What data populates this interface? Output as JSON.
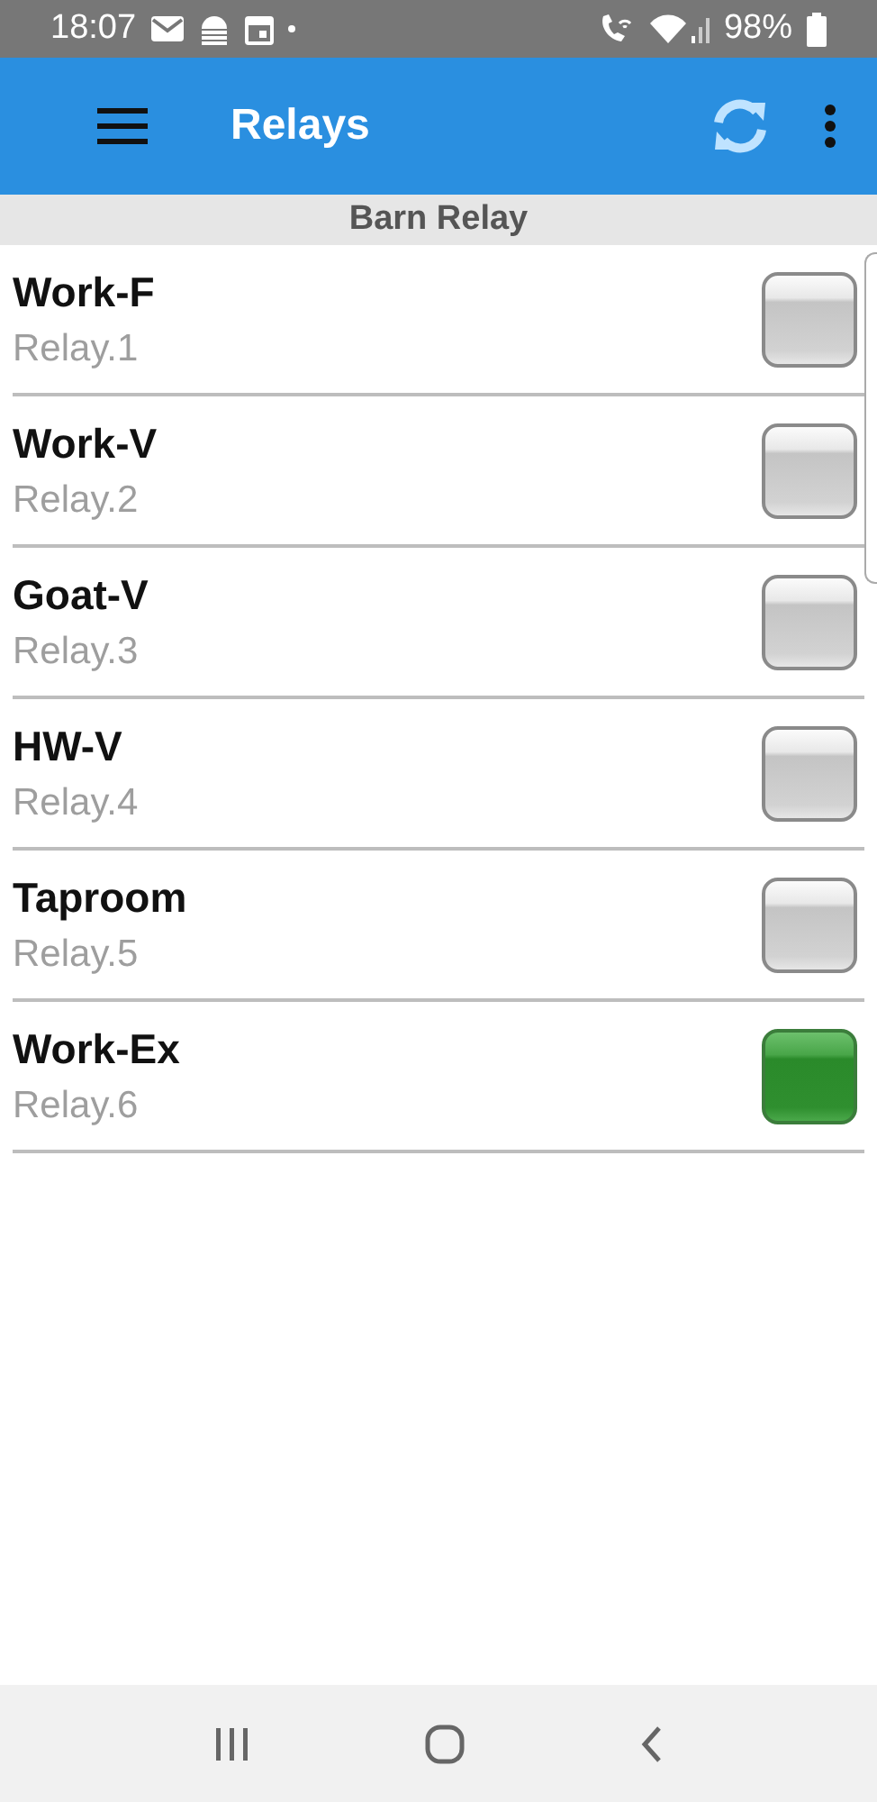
{
  "status_bar": {
    "time": "18:07",
    "battery": "98%"
  },
  "app_bar": {
    "title": "Relays"
  },
  "section": {
    "title": "Barn Relay"
  },
  "relays": [
    {
      "name": "Work-F",
      "id": "Relay.1",
      "on": false
    },
    {
      "name": "Work-V",
      "id": "Relay.2",
      "on": false
    },
    {
      "name": "Goat-V",
      "id": "Relay.3",
      "on": false
    },
    {
      "name": "HW-V",
      "id": "Relay.4",
      "on": false
    },
    {
      "name": "Taproom",
      "id": "Relay.5",
      "on": false
    },
    {
      "name": "Work-Ex",
      "id": "Relay.6",
      "on": true
    }
  ]
}
